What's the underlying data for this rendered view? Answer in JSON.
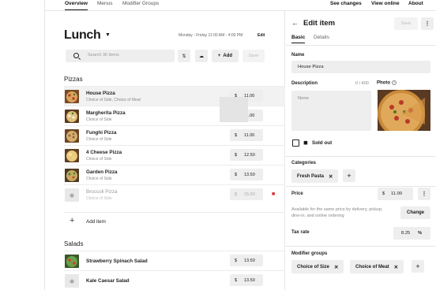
{
  "topnav": {
    "tabs": [
      "Overview",
      "Menus",
      "Modifier Groups"
    ],
    "active_tab": "Overview",
    "links": [
      "See changes",
      "View online",
      "About"
    ]
  },
  "menu": {
    "title": "Lunch",
    "hours": "Monday - Friday 11:00 AM - 4:00 PM",
    "edit_label": "Edit",
    "search_placeholder": "Search 36 items",
    "add_label": "Add",
    "save_label": "Save",
    "add_item_label": "Add item"
  },
  "sections": [
    {
      "title": "Pizzas",
      "items": [
        {
          "name": "House Pizza",
          "sub": "Choice of Side, Choice of Meat",
          "currency": "$",
          "price": "11.00",
          "selected": true
        },
        {
          "name": "Margherita Pizza",
          "sub": "Choice of Side",
          "currency": "$",
          "price": "11.00"
        },
        {
          "name": "Funghi Pizza",
          "sub": "Choice of Side",
          "currency": "$",
          "price": "11.00"
        },
        {
          "name": "4 Cheese Pizza",
          "sub": "Choice of Side",
          "currency": "$",
          "price": "12.50"
        },
        {
          "name": "Garden Pizza",
          "sub": "Choice of Side",
          "currency": "$",
          "price": "13.50"
        },
        {
          "name": "Broccoli Pizza",
          "sub": "Choice of Side",
          "currency": "$",
          "price": "15.50",
          "unavailable": true
        }
      ]
    },
    {
      "title": "Salads",
      "items": [
        {
          "name": "Strawberry Spinach Salad",
          "currency": "$",
          "price": "13.50"
        },
        {
          "name": "Kale Caesar Salad",
          "currency": "$",
          "price": "13.50"
        }
      ]
    }
  ],
  "panel": {
    "title": "Edit item",
    "save_label": "Save",
    "tabs": [
      "Basic",
      "Details"
    ],
    "name_label": "Name",
    "name_value": "House Pizza",
    "description_label": "Description",
    "description_count": "0 / 400",
    "description_placeholder": "None",
    "photo_label": "Photo",
    "sold_out_label": "Sold out",
    "categories_label": "Categories",
    "category_chip": "Fresh Pasta",
    "price_label": "Price",
    "price_currency": "$",
    "price_value": "11.00",
    "price_help": "Available for the same price by delivery, pickup, dine-in, and online ordering",
    "change_label": "Change",
    "tax_label": "Tax rate",
    "tax_value": "8.25",
    "tax_unit": "%",
    "modifier_label": "Modifier groups",
    "modifier_chips": [
      "Choice of Size",
      "Choice of Meat"
    ]
  },
  "icons": {
    "back": "arrow-left-icon",
    "more": "more-vertical-icon",
    "search": "search-icon",
    "filter": "filter-icon",
    "cloud": "cloud-upload-icon",
    "add": "plus-icon",
    "unavailable": "unavailable-icon",
    "sold_out": "sold-out-icon",
    "remove": "close-icon"
  },
  "colors": {
    "accent": "#111111",
    "control_bg": "#eeeeee",
    "alert": "#dd2222"
  }
}
